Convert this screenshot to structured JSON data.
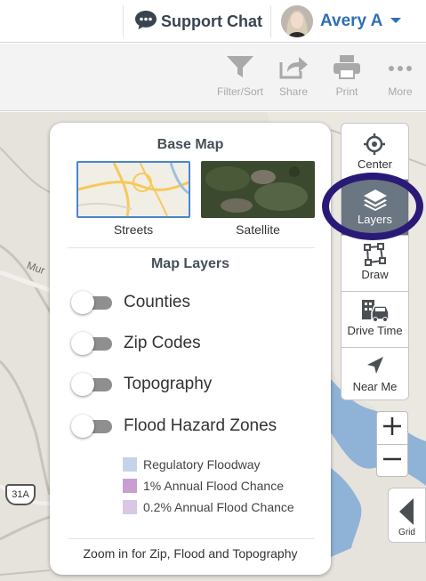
{
  "header": {
    "support_label": "Support Chat",
    "user_name": "Avery A"
  },
  "toolbar": {
    "items": [
      {
        "label": "Filter/Sort",
        "icon": "filter-icon"
      },
      {
        "label": "Share",
        "icon": "share-icon"
      },
      {
        "label": "Print",
        "icon": "print-icon"
      },
      {
        "label": "More",
        "icon": "more-icon"
      }
    ]
  },
  "map": {
    "labels": [
      "Mur",
      "31A"
    ]
  },
  "panel": {
    "base_map_title": "Base Map",
    "base_maps": [
      {
        "label": "Streets",
        "selected": true
      },
      {
        "label": "Satellite",
        "selected": false
      }
    ],
    "layers_title": "Map Layers",
    "layers": [
      {
        "label": "Counties",
        "on": false
      },
      {
        "label": "Zip Codes",
        "on": false
      },
      {
        "label": "Topography",
        "on": false
      },
      {
        "label": "Flood Hazard Zones",
        "on": false
      }
    ],
    "legend": [
      {
        "label": "Regulatory Floodway",
        "color": "#c5d3ea"
      },
      {
        "label": "1% Annual Flood Chance",
        "color": "#c89fd0"
      },
      {
        "label": "0.2% Annual Flood Chance",
        "color": "#d8c8e4"
      }
    ],
    "footer": "Zoom in for Zip, Flood and Topography"
  },
  "side_tools": [
    {
      "label": "Center",
      "icon": "crosshair-icon",
      "active": false
    },
    {
      "label": "Layers",
      "icon": "layers-icon",
      "active": true
    },
    {
      "label": "Draw",
      "icon": "draw-polygon-icon",
      "active": false
    },
    {
      "label": "Drive Time",
      "icon": "drive-time-icon",
      "active": false
    },
    {
      "label": "Near Me",
      "icon": "location-arrow-icon",
      "active": false
    }
  ],
  "zoom": {
    "in_label": "+",
    "out_label": "−"
  },
  "grid_button": {
    "label": "Grid",
    "icon": "chevron-left-icon"
  },
  "colors": {
    "accent": "#2f6fb5",
    "highlight_ring": "#2a1a78",
    "active_tool": "#6a7681",
    "water": "#8fb3d6"
  }
}
